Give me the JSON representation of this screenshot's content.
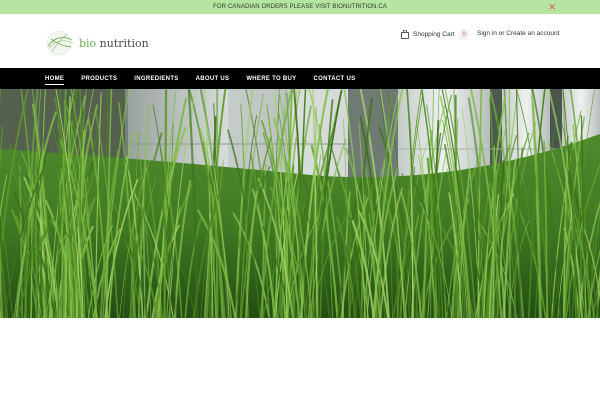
{
  "announcement": {
    "text": "FOR CANADIAN ORDERS PLEASE VISIT BIONUTRITION.CA",
    "close_icon": "close-icon",
    "close_glyph": "✕"
  },
  "logo": {
    "bio": "bio",
    "nutrition": " nutrition",
    "icon": "leaf-logo-icon"
  },
  "header": {
    "cart_label": "Shopping Cart",
    "cart_count": "0",
    "cart_icon": "shopping-bag-icon",
    "sign_in": "Sign in",
    "or": " or ",
    "create_account": "Create an account"
  },
  "nav": {
    "items": [
      {
        "label": "HOME"
      },
      {
        "label": "PRODUCTS"
      },
      {
        "label": "INGREDIENTS"
      },
      {
        "label": "ABOUT US"
      },
      {
        "label": "WHERE TO BUY"
      },
      {
        "label": "CONTACT US"
      }
    ]
  },
  "hero": {
    "image": "tall grass in front of concrete pillars"
  },
  "colors": {
    "announcement_bg": "#b5e5a0",
    "nav_bg": "#000000",
    "accent": "#6aa84f",
    "close": "#d9534f"
  }
}
